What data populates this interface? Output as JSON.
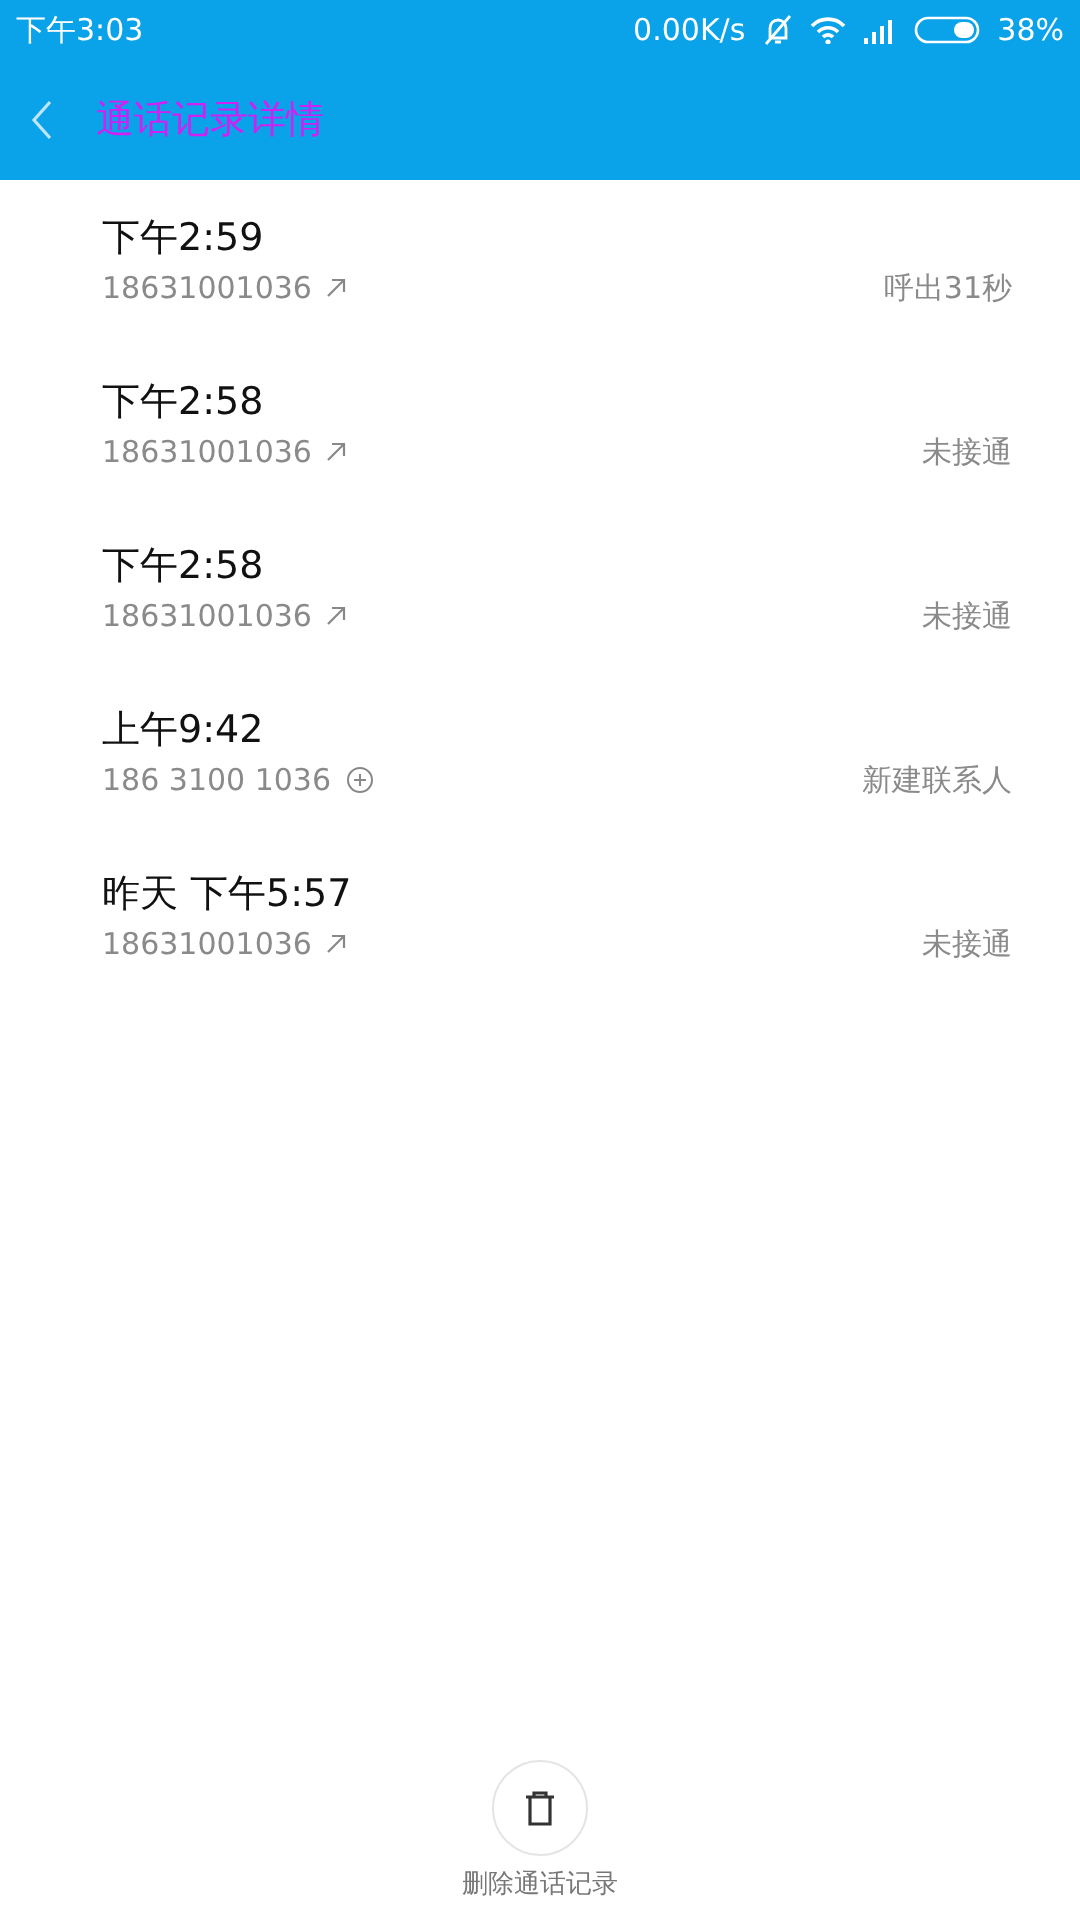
{
  "status_bar": {
    "time": "下午3:03",
    "network_speed": "0.00K/s",
    "battery": "38%"
  },
  "header": {
    "title": "通话记录详情"
  },
  "calls": [
    {
      "time": "下午2:59",
      "number": "18631001036",
      "kind": "outgoing",
      "status": "呼出31秒"
    },
    {
      "time": "下午2:58",
      "number": "18631001036",
      "kind": "outgoing",
      "status": "未接通"
    },
    {
      "time": "下午2:58",
      "number": "18631001036",
      "kind": "outgoing",
      "status": "未接通"
    },
    {
      "time": "上午9:42",
      "number": "186 3100 1036",
      "kind": "add",
      "status": "新建联系人"
    },
    {
      "time": "昨天 下午5:57",
      "number": "18631001036",
      "kind": "outgoing",
      "status": "未接通"
    }
  ],
  "delete_button": {
    "label": "删除通话记录"
  }
}
